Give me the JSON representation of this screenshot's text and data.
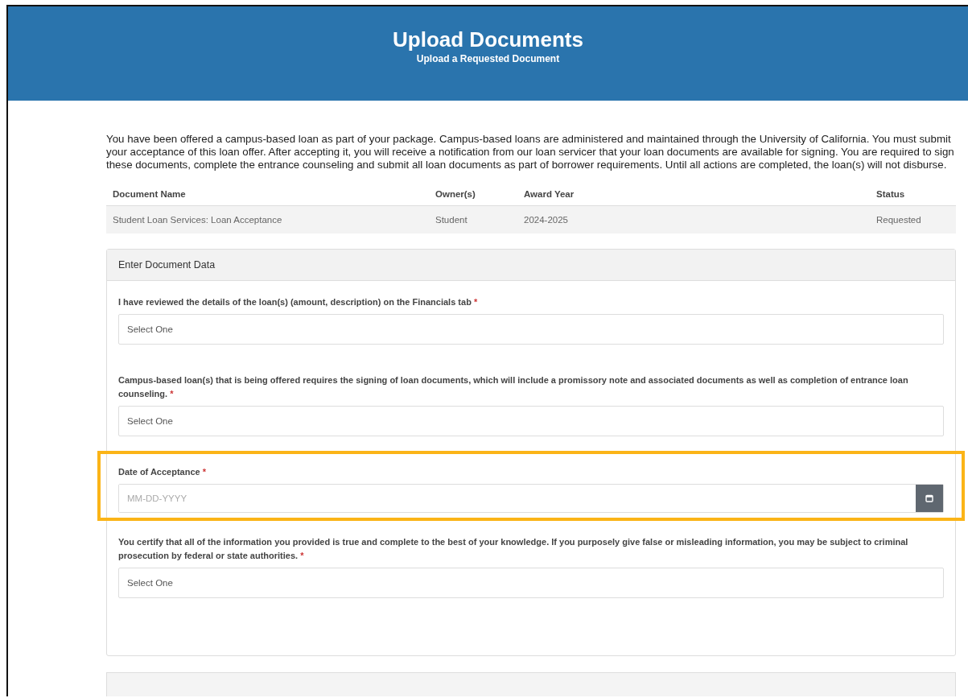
{
  "header": {
    "title": "Upload Documents",
    "subtitle": "Upload a Requested Document"
  },
  "intro": "You have been offered a campus-based loan as part of your package. Campus-based loans are administered and maintained through the University of California. You must submit your acceptance of this loan offer. After accepting it, you will receive a notification from our loan servicer that your loan documents are available for signing. You are required to sign these documents, complete the entrance counseling and submit all loan documents as part of borrower requirements. Until all actions are completed, the loan(s) will not disburse.",
  "table": {
    "columns": [
      "Document Name",
      "Owner(s)",
      "Award Year",
      "Status"
    ],
    "rows": [
      [
        "Student Loan Services: Loan Acceptance",
        "Student",
        "2024-2025",
        "Requested"
      ]
    ]
  },
  "panel": {
    "title": "Enter Document Data",
    "fields": [
      {
        "kind": "select",
        "label": "I have reviewed the details of the loan(s) (amount, description) on the Financials tab",
        "required": "*",
        "value": "Select One",
        "highlighted": false
      },
      {
        "kind": "select",
        "label": "Campus-based loan(s) that is being offered requires the signing of loan documents, which will include a promissory note and associated documents as well as completion of entrance loan counseling.",
        "required": "*",
        "value": "Select One",
        "highlighted": false
      },
      {
        "kind": "date",
        "label": "Date of Acceptance",
        "required": "*",
        "placeholder": "MM-DD-YYYY",
        "highlighted": true
      },
      {
        "kind": "select",
        "label": "You certify that all of the information you provided is true and complete to the best of your knowledge. If you purposely give false or misleading information, you may be subject to criminal prosecution by federal or state authorities.",
        "required": "*",
        "value": "Select One",
        "highlighted": false
      }
    ]
  }
}
